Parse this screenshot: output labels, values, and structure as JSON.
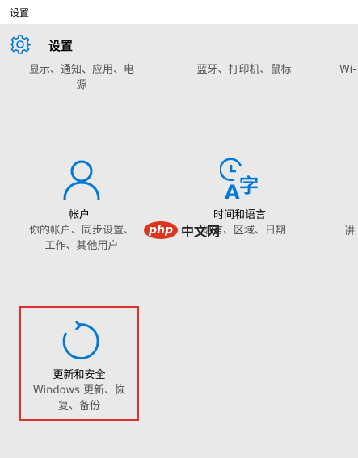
{
  "window": {
    "title": "设置"
  },
  "header": {
    "heading": "设置",
    "icon": "gear-icon"
  },
  "top_row": {
    "system_desc_line1": "显示、通知、应用、电",
    "system_desc_line2": "源",
    "devices_desc": "蓝牙、打印机、鼠标",
    "network_desc_partial": "Wi-"
  },
  "tiles": {
    "accounts": {
      "name": "帐户",
      "desc_line1": "你的帐户、同步设置、",
      "desc_line2": "工作、其他用户",
      "icon": "user-icon"
    },
    "time_language": {
      "name": "时间和语言",
      "desc_line1": "语言、区域、日期",
      "icon": "time-language-icon"
    },
    "ease_partial": {
      "desc_partial": "讲"
    },
    "update_security": {
      "name": "更新和安全",
      "desc_line1": "Windows 更新、恢",
      "desc_line2": "复、备份",
      "icon": "refresh-icon"
    }
  },
  "watermark": {
    "badge": "php",
    "text": "中文网"
  },
  "colors": {
    "accent": "#0078d7",
    "highlight": "#e03131",
    "background": "#e9e9e9"
  }
}
